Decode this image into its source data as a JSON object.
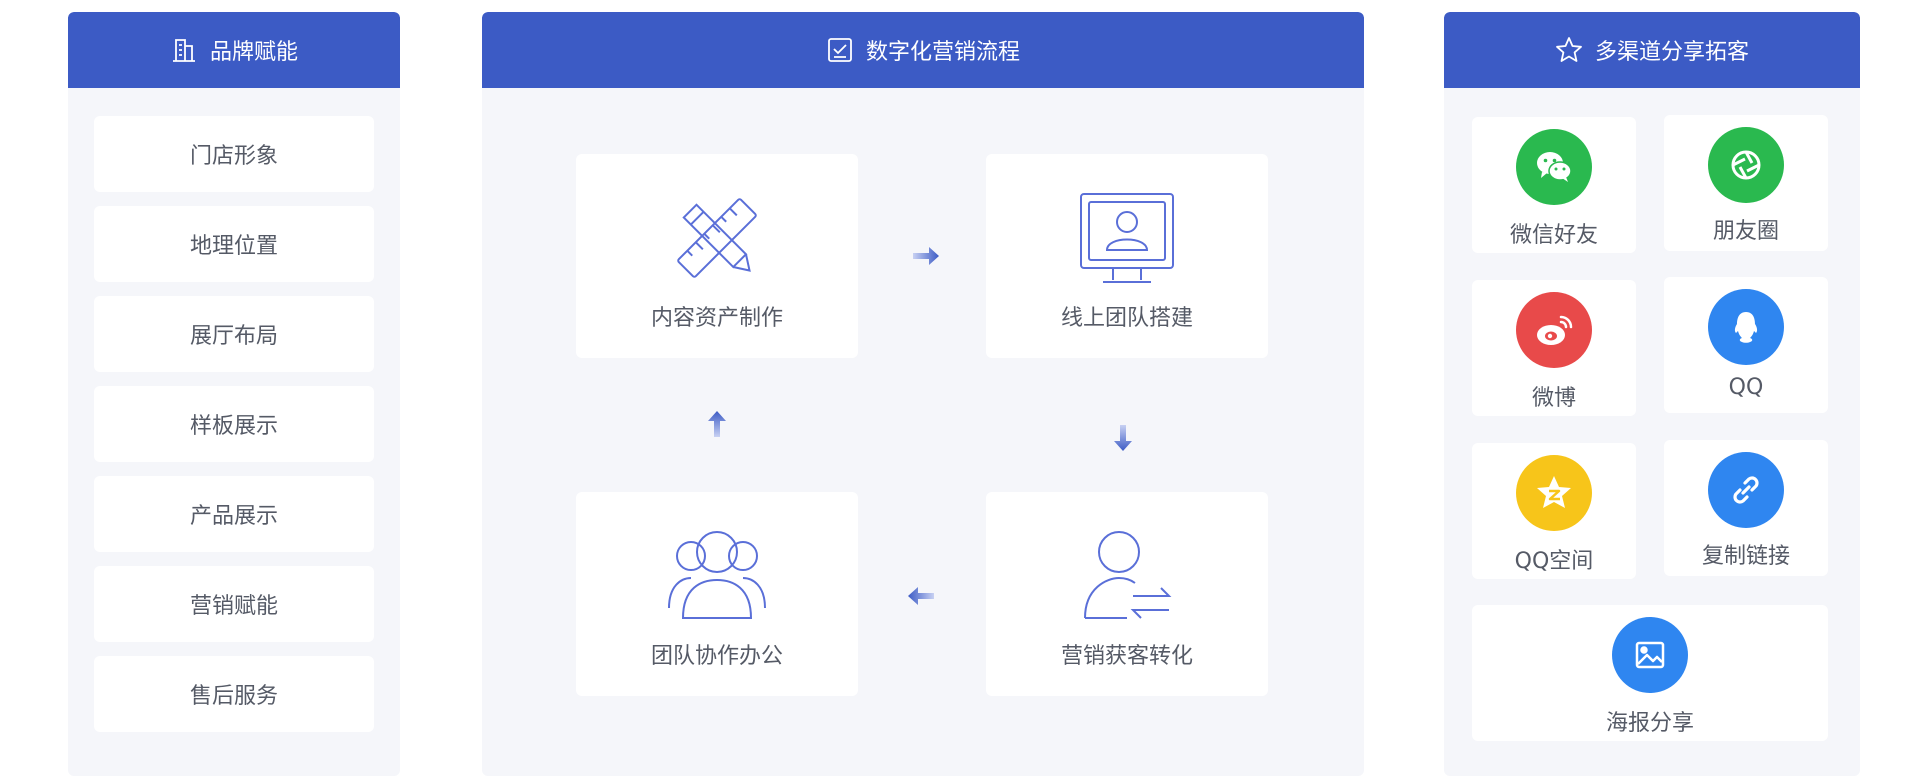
{
  "colors": {
    "header": "#3c5bc5",
    "panel_bg": "#f5f6fa",
    "text": "#555a66",
    "icon_line": "#5a6fd8"
  },
  "left": {
    "title": "品牌赋能",
    "icon": "building-icon",
    "items": [
      "门店形象",
      "地理位置",
      "展厅布局",
      "样板展示",
      "产品展示",
      "营销赋能",
      "售后服务"
    ]
  },
  "middle": {
    "title": "数字化营销流程",
    "icon": "checkbox-icon",
    "steps": [
      {
        "label": "内容资产制作",
        "icon": "ruler-pencil-icon"
      },
      {
        "label": "线上团队搭建",
        "icon": "monitor-user-icon"
      },
      {
        "label": "营销获客转化",
        "icon": "user-exchange-icon"
      },
      {
        "label": "团队协作办公",
        "icon": "team-icon"
      }
    ]
  },
  "right": {
    "title": "多渠道分享拓客",
    "icon": "star-icon",
    "channels": [
      {
        "label": "微信好友",
        "icon": "wechat-icon",
        "color": "#2ab94f"
      },
      {
        "label": "朋友圈",
        "icon": "moments-icon",
        "color": "#2ab94f"
      },
      {
        "label": "微博",
        "icon": "weibo-icon",
        "color": "#e84a4a"
      },
      {
        "label": "QQ",
        "icon": "qq-icon",
        "color": "#2f86f0"
      },
      {
        "label": "QQ空间",
        "icon": "qzone-icon",
        "color": "#f7c51a"
      },
      {
        "label": "复制链接",
        "icon": "link-icon",
        "color": "#2f86f0"
      },
      {
        "label": "海报分享",
        "icon": "poster-icon",
        "color": "#2f86f0"
      }
    ]
  }
}
